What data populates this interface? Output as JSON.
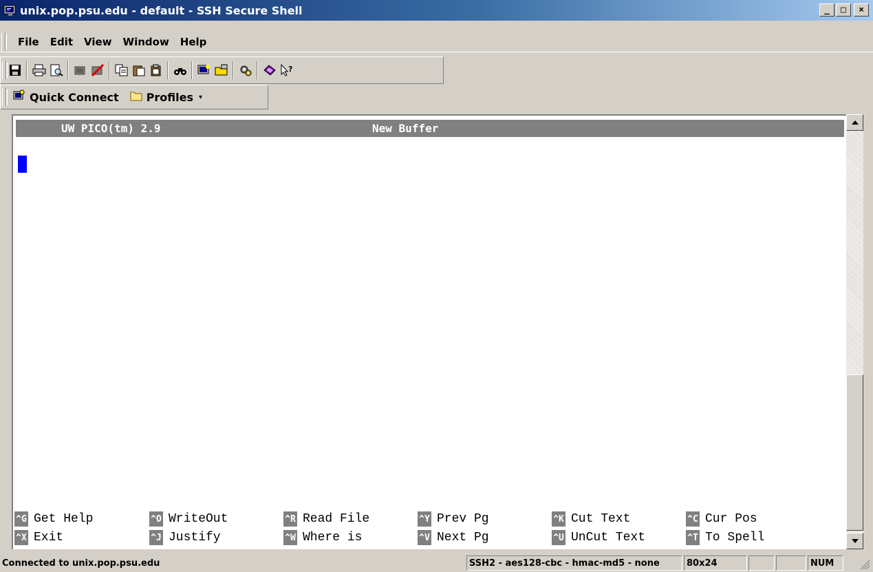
{
  "window": {
    "title": "unix.pop.psu.edu - default - SSH Secure Shell",
    "min_label": "_",
    "max_label": "□",
    "close_label": "×"
  },
  "menu": [
    "File",
    "Edit",
    "View",
    "Window",
    "Help"
  ],
  "toolbar": {
    "icons": [
      "save-icon",
      "print-icon",
      "print-preview-icon",
      "disconnect-icon",
      "reconnect-icon",
      "copy-icon",
      "paste-icon",
      "paste-special-icon",
      "find-icon",
      "new-terminal-icon",
      "file-transfer-icon",
      "settings-icon",
      "help-icon",
      "context-help-icon"
    ]
  },
  "quickbar": {
    "quick_connect_label": "Quick Connect",
    "profiles_label": "Profiles",
    "profiles_dropdown": "▾"
  },
  "terminal": {
    "header_program": "UW PICO(tm) 2.9",
    "header_buffer": "New Buffer",
    "shortcuts_row1": [
      {
        "key": "^G",
        "action": "Get Help"
      },
      {
        "key": "^O",
        "action": "WriteOut"
      },
      {
        "key": "^R",
        "action": "Read File"
      },
      {
        "key": "^Y",
        "action": "Prev Pg"
      },
      {
        "key": "^K",
        "action": "Cut Text"
      },
      {
        "key": "^C",
        "action": "Cur Pos"
      }
    ],
    "shortcuts_row2": [
      {
        "key": "^X",
        "action": "Exit"
      },
      {
        "key": "^J",
        "action": "Justify"
      },
      {
        "key": "^W",
        "action": "Where is"
      },
      {
        "key": "^V",
        "action": "Next Pg"
      },
      {
        "key": "^U",
        "action": "UnCut Text"
      },
      {
        "key": "^T",
        "action": "To Spell"
      }
    ]
  },
  "status": {
    "connection": "Connected to unix.pop.psu.edu",
    "cipher": "SSH2 - aes128-cbc - hmac-md5 - none",
    "size": "80x24",
    "num": "NUM"
  },
  "colors": {
    "titlebar_start": "#0a246a",
    "cursor": "#0000ff",
    "header_bg": "#808080",
    "chrome": "#d4d0c8"
  }
}
